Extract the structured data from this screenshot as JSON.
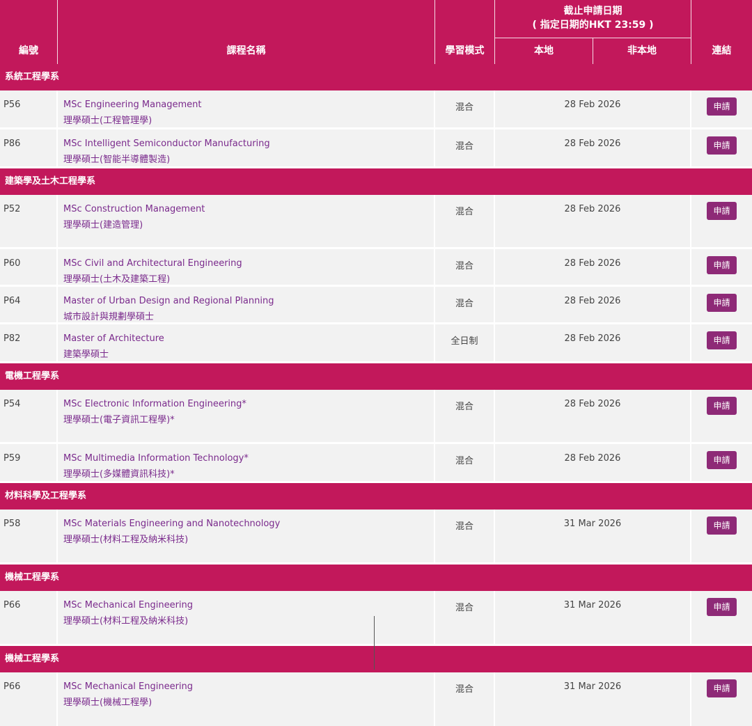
{
  "header": {
    "col_code": "編號",
    "col_name": "課程名稱",
    "col_mode": "學習模式",
    "deadline_line1": "截止申請日期",
    "deadline_line2": "( 指定日期的HKT 23:59 )",
    "col_local": "本地",
    "col_nonlocal": "非本地",
    "col_link": "連結"
  },
  "sections": [
    {
      "title": "系統工程學系",
      "rows": [
        {
          "code": "P56",
          "en": "MSc Engineering Management",
          "zh": "理學碩士(工程管理學)",
          "mode": "混合",
          "date": "28 Feb 2026",
          "button": "申請"
        },
        {
          "code": "P86",
          "en": "MSc Intelligent Semiconductor Manufacturing",
          "zh": "理學碩士(智能半導體製造)",
          "mode": "混合",
          "date": "28 Feb 2026",
          "button": "申請"
        }
      ]
    },
    {
      "title": "建築學及土木工程學系",
      "rows": [
        {
          "code": "P52",
          "en": "MSc Construction Management",
          "zh": "理學碩士(建造管理)",
          "mode": "混合",
          "date": "28 Feb 2026",
          "button": "申請"
        },
        {
          "code": "P60",
          "en": "MSc Civil and Architectural Engineering",
          "zh": "理學碩士(土木及建築工程)",
          "mode": "混合",
          "date": "28 Feb 2026",
          "button": "申請"
        },
        {
          "code": "P64",
          "en": "Master of Urban Design and Regional Planning",
          "zh": "城市設計與規劃學碩士",
          "mode": "混合",
          "date": "28 Feb 2026",
          "button": "申請"
        },
        {
          "code": "P82",
          "en": "Master of Architecture",
          "zh": "建築學碩士",
          "mode": "全日制",
          "date": "28 Feb 2026",
          "button": "申請"
        }
      ]
    },
    {
      "title": "電機工程學系",
      "rows": [
        {
          "code": "P54",
          "en": "MSc Electronic Information Engineering*",
          "zh": "理學碩士(電子資訊工程學)*",
          "mode": "混合",
          "date": "28 Feb 2026",
          "button": "申請"
        },
        {
          "code": "P59",
          "en": "MSc Multimedia Information Technology*",
          "zh": "理學碩士(多媒體資訊科技)*",
          "mode": "混合",
          "date": "28 Feb 2026",
          "button": "申請"
        }
      ]
    },
    {
      "title": "材料科學及工程學系",
      "rows": [
        {
          "code": "P58",
          "en": "MSc Materials Engineering and Nanotechnology",
          "zh": "理學碩士(材料工程及納米科技)",
          "mode": "混合",
          "date": "31 Mar 2026",
          "button": "申請"
        }
      ]
    },
    {
      "title": "機械工程學系",
      "rows": [
        {
          "code": "P66",
          "en": "MSc Mechanical Engineering",
          "zh": "理學碩士(材料工程及納米科技)",
          "mode": "混合",
          "date": "31 Mar 2026",
          "button": "申請"
        }
      ]
    },
    {
      "title": "機械工程學系",
      "rows": [
        {
          "code": "P66",
          "en": "MSc Mechanical Engineering",
          "zh": "理學碩士(機械工程學)",
          "mode": "混合",
          "date": "31 Mar 2026",
          "button": "申請"
        }
      ]
    }
  ]
}
